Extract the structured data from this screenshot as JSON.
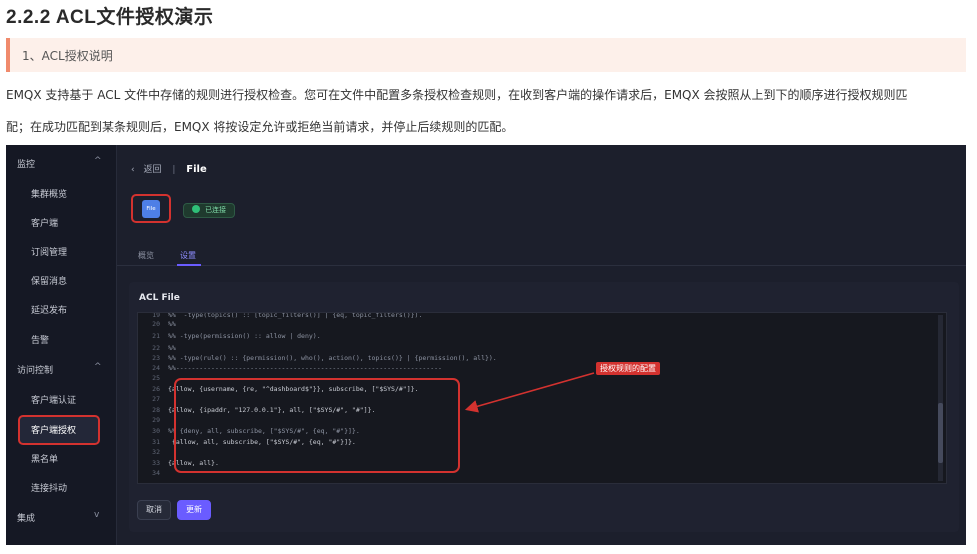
{
  "doc": {
    "heading": "2.2.2 ACL文件授权演示",
    "callout": "1、ACL授权说明",
    "paragraph_line1": "EMQX 支持基于 ACL 文件中存储的规则进行授权检查。您可在文件中配置多条授权检查规则，在收到客户端的操作请求后，EMQX 会按照从上到下的顺序进行授权规则匹",
    "paragraph_line2": "配；在成功匹配到某条规则后，EMQX 将按设定允许或拒绝当前请求，并停止后续规则的匹配。"
  },
  "sidebar": {
    "items": [
      {
        "label": "监控",
        "kind": "group",
        "chevron": "^"
      },
      {
        "label": "集群概览",
        "kind": "sub"
      },
      {
        "label": "客户端",
        "kind": "sub"
      },
      {
        "label": "订阅管理",
        "kind": "sub"
      },
      {
        "label": "保留消息",
        "kind": "sub"
      },
      {
        "label": "延迟发布",
        "kind": "sub"
      },
      {
        "label": "告警",
        "kind": "sub"
      },
      {
        "label": "访问控制",
        "kind": "group",
        "chevron": "^"
      },
      {
        "label": "客户端认证",
        "kind": "sub"
      },
      {
        "label": "客户端授权",
        "kind": "sub",
        "active": true
      },
      {
        "label": "黑名单",
        "kind": "sub"
      },
      {
        "label": "连接抖动",
        "kind": "sub"
      },
      {
        "label": "集成",
        "kind": "group",
        "chevron": "v"
      }
    ]
  },
  "breadcrumb": {
    "back": "返回",
    "current": "File"
  },
  "file_badge": "File",
  "status": "已连接",
  "tabs": [
    "概览",
    "设置"
  ],
  "acl": {
    "title": "ACL File",
    "lines": [
      {
        "n": "19",
        "t": "%%  -type(topics() :: [topic_filters()] | {eq, topic_filters()}).",
        "comment": true
      },
      {
        "n": "20",
        "t": "%%",
        "comment": true
      },
      {
        "n": "21",
        "t": "%% -type(permission() :: allow | deny).",
        "comment": true
      },
      {
        "n": "22",
        "t": "%%",
        "comment": true
      },
      {
        "n": "23",
        "t": "%% -type(rule() :: {permission(), who(), action(), topics()} | {permission(), all}).",
        "comment": true
      },
      {
        "n": "24",
        "t": "%%--------------------------------------------------------------------",
        "comment": true
      },
      {
        "n": "25",
        "t": ""
      },
      {
        "n": "26",
        "t": "{allow, {username, {re, \"^dashboard$\"}}, subscribe, [\"$SYS/#\"]}."
      },
      {
        "n": "27",
        "t": ""
      },
      {
        "n": "28",
        "t": "{allow, {ipaddr, \"127.0.0.1\"}, all, [\"$SYS/#\", \"#\"]}."
      },
      {
        "n": "29",
        "t": ""
      },
      {
        "n": "30",
        "t": "%% {deny, all, subscribe, [\"$SYS/#\", {eq, \"#\"}]}.",
        "comment": true
      },
      {
        "n": "31",
        "t": " {allow, all, subscribe, [\"$SYS/#\", {eq, \"#\"}]}."
      },
      {
        "n": "32",
        "t": ""
      },
      {
        "n": "33",
        "t": "{allow, all}."
      },
      {
        "n": "34",
        "t": ""
      }
    ]
  },
  "annotation": "授权规则的配置",
  "buttons": {
    "cancel": "取消",
    "update": "更新"
  },
  "colors": {
    "accent": "#6a5cff",
    "highlight_red": "#d3322f",
    "dark_bg": "#1c1f2c"
  }
}
